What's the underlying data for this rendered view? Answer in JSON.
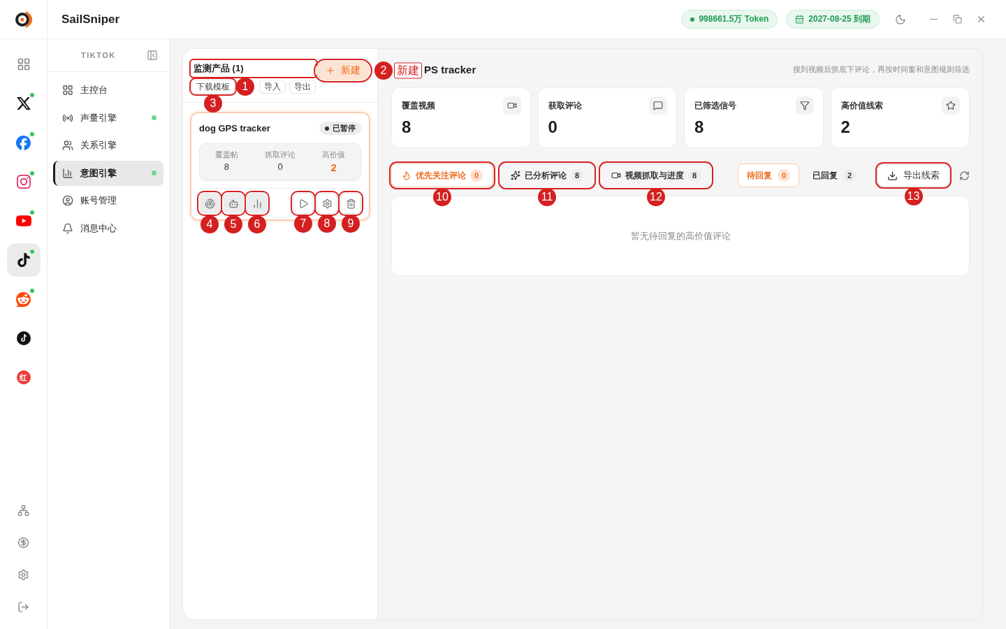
{
  "app": {
    "name": "SailSniper"
  },
  "top_bar": {
    "token": "998661.5万 Token",
    "expiry": "2027-08-25 到期"
  },
  "platform_rail": {
    "items": [
      {
        "kind": "grid",
        "selected": false,
        "online": false
      },
      {
        "kind": "x",
        "selected": false,
        "online": true
      },
      {
        "kind": "facebook",
        "selected": false,
        "online": true
      },
      {
        "kind": "instagram",
        "selected": false,
        "online": true
      },
      {
        "kind": "youtube",
        "selected": false,
        "online": true
      },
      {
        "kind": "tiktok",
        "selected": true,
        "online": true
      },
      {
        "kind": "reddit",
        "selected": false,
        "online": true
      },
      {
        "kind": "tiktok-dark",
        "selected": false,
        "online": false
      },
      {
        "kind": "badge",
        "text": "红",
        "selected": false,
        "online": false
      }
    ],
    "bottom": [
      {
        "kind": "network"
      },
      {
        "kind": "billing"
      },
      {
        "kind": "settings"
      },
      {
        "kind": "logout"
      }
    ]
  },
  "nav": {
    "platform": "TIKTOK",
    "items": [
      {
        "label": "主控台",
        "selected": false,
        "online": false
      },
      {
        "label": "声量引擎",
        "selected": false,
        "online": true
      },
      {
        "label": "关系引擎",
        "selected": false,
        "online": false
      },
      {
        "label": "意图引擎",
        "selected": true,
        "online": true
      },
      {
        "label": "账号管理",
        "selected": false,
        "online": false
      },
      {
        "label": "消息中心",
        "selected": false,
        "online": false
      }
    ]
  },
  "products": {
    "title": {
      "text": "监测产品 (1)",
      "outlined": true
    },
    "new_button": {
      "label": "新建",
      "outlined": true,
      "callouts": [
        {
          "number": "2",
          "tag": "新建"
        }
      ]
    },
    "chips": [
      {
        "label": "下载模板",
        "outlined": true,
        "callouts": [
          {
            "number": "1"
          },
          {
            "number": "3"
          }
        ]
      },
      {
        "label": "导入",
        "outlined": false
      },
      {
        "label": "导出",
        "outlined": false
      }
    ],
    "items": [
      {
        "name": "dog GPS tracker",
        "status": "已暂停",
        "selected": true,
        "stats": [
          {
            "label": "覆盖帖",
            "value": "8",
            "highlight": false
          },
          {
            "label": "抓取评论",
            "value": "0",
            "highlight": false
          },
          {
            "label": "高价值",
            "value": "2",
            "highlight": true
          }
        ],
        "primary_actions": [
          {
            "kind": "radar",
            "outlined": true,
            "callouts": [
              {
                "number": "4"
              }
            ]
          },
          {
            "kind": "bot",
            "outlined": true,
            "callouts": [
              {
                "number": "5"
              }
            ]
          },
          {
            "kind": "chart",
            "outlined": true,
            "callouts": [
              {
                "number": "6"
              }
            ]
          }
        ],
        "secondary_actions": [
          {
            "kind": "play",
            "outlined": true,
            "callouts": [
              {
                "number": "7"
              }
            ]
          },
          {
            "kind": "settings",
            "outlined": true,
            "callouts": [
              {
                "number": "8"
              }
            ]
          },
          {
            "kind": "delete",
            "outlined": true,
            "callouts": [
              {
                "number": "9"
              }
            ]
          }
        ]
      }
    ]
  },
  "detail": {
    "title": "PS tracker",
    "hint": "搜到视频后抓底下评论，再按时间窗和意图规则筛选",
    "stats": [
      {
        "label": "覆盖视频",
        "value": "8",
        "kind": "video"
      },
      {
        "label": "获取评论",
        "value": "0",
        "kind": "message"
      },
      {
        "label": "已筛选信号",
        "value": "8",
        "kind": "filter"
      },
      {
        "label": "高价值线索",
        "value": "2",
        "kind": "star"
      }
    ],
    "tabs": [
      {
        "label": "优先关注评论",
        "count": "0",
        "kind": "flame",
        "selected": true,
        "outlined": true,
        "callouts": [
          {
            "number": "10"
          }
        ]
      },
      {
        "label": "已分析评论",
        "count": "8",
        "kind": "sparkles",
        "selected": false,
        "outlined": true,
        "callouts": [
          {
            "number": "11"
          }
        ]
      },
      {
        "label": "视频抓取与进度",
        "count": "8",
        "kind": "video",
        "selected": false,
        "outlined": true,
        "callouts": [
          {
            "number": "12"
          }
        ]
      }
    ],
    "reply_filters": [
      {
        "label": "待回复",
        "count": "0",
        "selected": true
      },
      {
        "label": "已回复",
        "count": "2",
        "selected": false
      }
    ],
    "export_button": {
      "label": "导出线索",
      "outlined": true,
      "callouts": [
        {
          "number": "13"
        }
      ]
    },
    "empty_text": "暂无待回复的高价值评论"
  }
}
